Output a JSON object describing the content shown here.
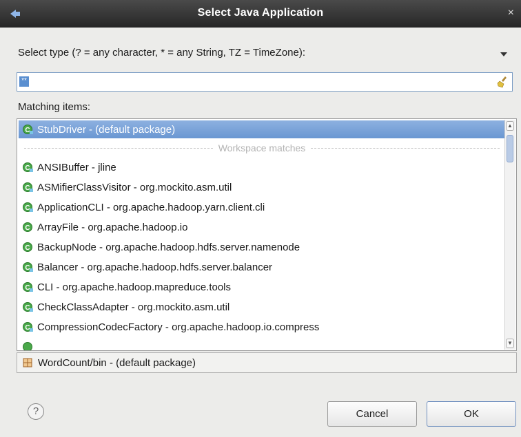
{
  "window": {
    "title": "Select Java Application",
    "close_glyph": "×"
  },
  "prompt": {
    "label": "Select type (? = any character, * = any String, TZ = TimeZone):"
  },
  "search": {
    "value": "",
    "selected_text": "**"
  },
  "matching": {
    "label": "Matching items:"
  },
  "list": {
    "selected": {
      "label": "StubDriver - (default package)",
      "icon": "class-icon"
    },
    "separator": "Workspace matches",
    "items": [
      {
        "label": "ANSIBuffer - jline",
        "icon": "class-icon"
      },
      {
        "label": "ASMifierClassVisitor - org.mockito.asm.util",
        "icon": "class-icon"
      },
      {
        "label": "ApplicationCLI - org.apache.hadoop.yarn.client.cli",
        "icon": "class-icon"
      },
      {
        "label": "ArrayFile - org.apache.hadoop.io",
        "icon": "class-icon"
      },
      {
        "label": "BackupNode - org.apache.hadoop.hdfs.server.namenode",
        "icon": "class-icon"
      },
      {
        "label": "Balancer - org.apache.hadoop.hdfs.server.balancer",
        "icon": "class-icon"
      },
      {
        "label": "CLI - org.apache.hadoop.mapreduce.tools",
        "icon": "class-icon"
      },
      {
        "label": "CheckClassAdapter - org.mockito.asm.util",
        "icon": "class-icon"
      },
      {
        "label": "CompressionCodecFactory - org.apache.hadoop.io.compress",
        "icon": "class-icon"
      }
    ]
  },
  "location": {
    "label": "WordCount/bin - (default package)",
    "icon": "package-icon"
  },
  "buttons": {
    "help": "?",
    "cancel": "Cancel",
    "ok": "OK"
  },
  "colors": {
    "selection": "#6a97d2",
    "class_icon": "#3a9a3a",
    "titlebar": "#2e2e2e"
  }
}
